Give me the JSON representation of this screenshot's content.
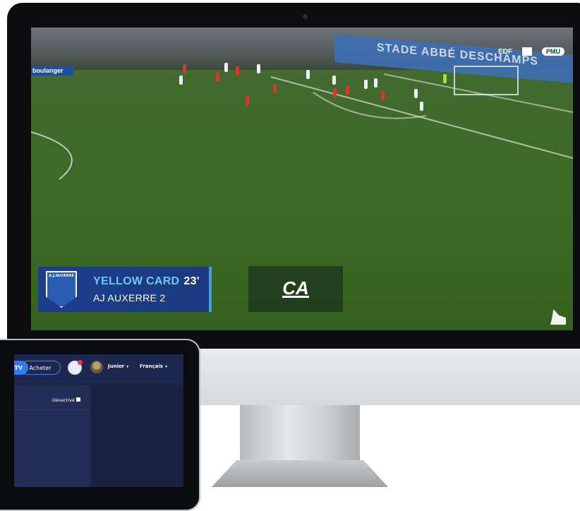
{
  "broadcast": {
    "card": {
      "event": "YELLOW CARD",
      "minute": "23'",
      "team": "AJ AUXERRE 2",
      "crest_label": "A.J.AUXERRE"
    },
    "stadium_board": "STADE ABBÉ DESCHAMPS",
    "ad_board": "boulanger",
    "sponsors": [
      "EDF",
      "PMU"
    ],
    "sponsor_overlay_logo": "CA"
  },
  "tablet_app": {
    "topbar": {
      "tv_label": "TV",
      "buy_label": "Acheter",
      "user_label": "Junior",
      "language_label": "Français"
    },
    "panel": {
      "toggle_label": "Désactivé"
    }
  },
  "colors": {
    "card_bg": "#1b3d8c",
    "card_accent": "#6cc8f2",
    "tablet_bg": "#1c2546",
    "primary_button": "#2f7ee8"
  }
}
